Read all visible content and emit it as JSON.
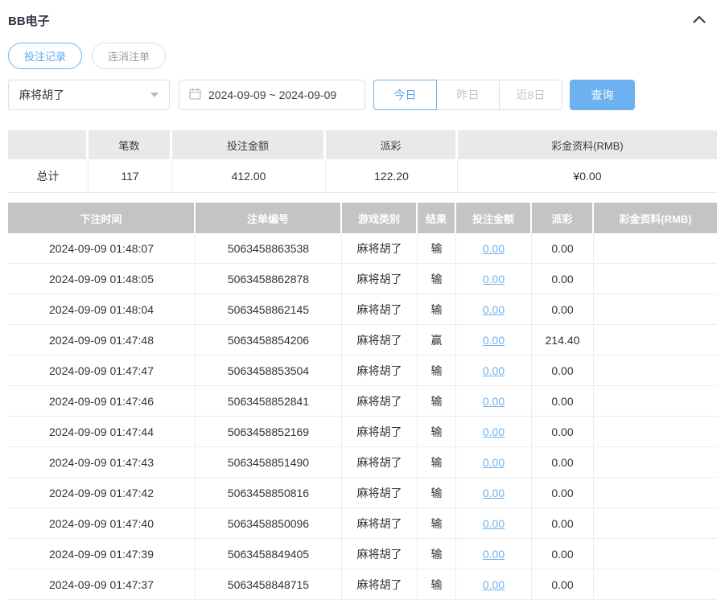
{
  "header": {
    "title": "BB电子"
  },
  "tabs": [
    {
      "key": "bet-records",
      "label": "投注记录",
      "active": true
    },
    {
      "key": "cancelled-orders",
      "label": "连消注单",
      "active": false
    }
  ],
  "filters": {
    "game_select": {
      "value": "麻将胡了"
    },
    "date_range": {
      "value": "2024-09-09 ~ 2024-09-09"
    },
    "quick_buttons": [
      {
        "key": "today",
        "label": "今日",
        "active": true
      },
      {
        "key": "yesterday",
        "label": "昨日",
        "active": false
      },
      {
        "key": "last-8-days",
        "label": "近8日",
        "active": false
      }
    ],
    "query_button_label": "查询"
  },
  "summary": {
    "headers": [
      "",
      "笔数",
      "投注金额",
      "派彩",
      "彩金资料(RMB)"
    ],
    "total_label": "总计",
    "count": "117",
    "bet_amount": "412.00",
    "payout": "122.20",
    "bonus": "¥0.00"
  },
  "table": {
    "columns": [
      {
        "key": "time",
        "label": "下注时间"
      },
      {
        "key": "order",
        "label": "注单编号"
      },
      {
        "key": "game",
        "label": "游戏类别"
      },
      {
        "key": "result",
        "label": "结果"
      },
      {
        "key": "bet",
        "label": "投注金额"
      },
      {
        "key": "payout",
        "label": "派彩"
      },
      {
        "key": "bonus",
        "label": "彩金资料(RMB)"
      }
    ],
    "rows": [
      {
        "time": "2024-09-09 01:48:07",
        "order": "5063458863538",
        "game": "麻将胡了",
        "result": "输",
        "bet": "0.00",
        "payout": "0.00",
        "bonus": ""
      },
      {
        "time": "2024-09-09 01:48:05",
        "order": "5063458862878",
        "game": "麻将胡了",
        "result": "输",
        "bet": "0.00",
        "payout": "0.00",
        "bonus": ""
      },
      {
        "time": "2024-09-09 01:48:04",
        "order": "5063458862145",
        "game": "麻将胡了",
        "result": "输",
        "bet": "0.00",
        "payout": "0.00",
        "bonus": ""
      },
      {
        "time": "2024-09-09 01:47:48",
        "order": "5063458854206",
        "game": "麻将胡了",
        "result": "赢",
        "bet": "0.00",
        "payout": "214.40",
        "bonus": ""
      },
      {
        "time": "2024-09-09 01:47:47",
        "order": "5063458853504",
        "game": "麻将胡了",
        "result": "输",
        "bet": "0.00",
        "payout": "0.00",
        "bonus": ""
      },
      {
        "time": "2024-09-09 01:47:46",
        "order": "5063458852841",
        "game": "麻将胡了",
        "result": "输",
        "bet": "0.00",
        "payout": "0.00",
        "bonus": ""
      },
      {
        "time": "2024-09-09 01:47:44",
        "order": "5063458852169",
        "game": "麻将胡了",
        "result": "输",
        "bet": "0.00",
        "payout": "0.00",
        "bonus": ""
      },
      {
        "time": "2024-09-09 01:47:43",
        "order": "5063458851490",
        "game": "麻将胡了",
        "result": "输",
        "bet": "0.00",
        "payout": "0.00",
        "bonus": ""
      },
      {
        "time": "2024-09-09 01:47:42",
        "order": "5063458850816",
        "game": "麻将胡了",
        "result": "输",
        "bet": "0.00",
        "payout": "0.00",
        "bonus": ""
      },
      {
        "time": "2024-09-09 01:47:40",
        "order": "5063458850096",
        "game": "麻将胡了",
        "result": "输",
        "bet": "0.00",
        "payout": "0.00",
        "bonus": ""
      },
      {
        "time": "2024-09-09 01:47:39",
        "order": "5063458849405",
        "game": "麻将胡了",
        "result": "输",
        "bet": "0.00",
        "payout": "0.00",
        "bonus": ""
      },
      {
        "time": "2024-09-09 01:47:37",
        "order": "5063458848715",
        "game": "麻将胡了",
        "result": "输",
        "bet": "0.00",
        "payout": "0.00",
        "bonus": ""
      }
    ]
  },
  "colors": {
    "accent_blue": "#6cb2f0",
    "table_header_bg": "#c4c4c4",
    "summary_header_bg": "#e9e9e9",
    "row_border": "#ececec",
    "link_blue": "#6cb2f0"
  }
}
